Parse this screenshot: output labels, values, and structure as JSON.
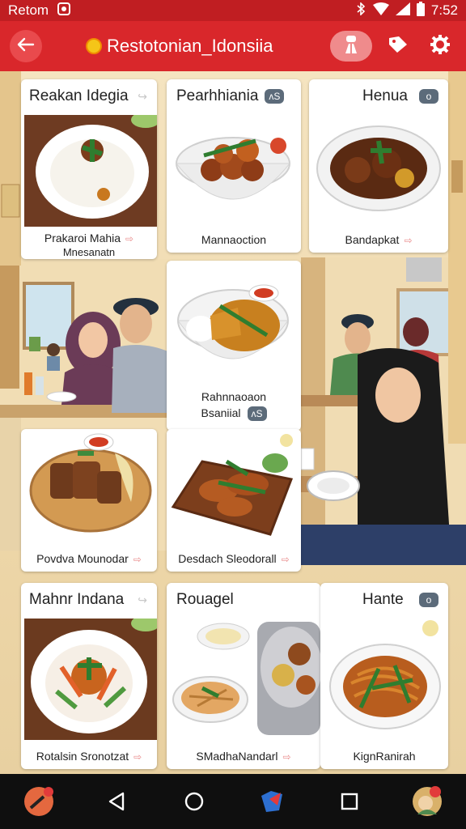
{
  "status_bar": {
    "carrier": "Retom",
    "time": "7:52",
    "icons": [
      "notification-icon",
      "bluetooth-icon",
      "wifi-icon",
      "signal-icon",
      "battery-icon"
    ]
  },
  "app_bar": {
    "title": "Restotonian_Idonsiia",
    "back_icon": "back-arrow-icon",
    "actions": [
      "chef-icon",
      "tag-icon",
      "settings-gear-icon"
    ]
  },
  "cards": [
    {
      "title": "Reakan Idegia",
      "caption": "Prakaroi Mahia",
      "caption2": "Mnesanatn"
    },
    {
      "title": "Pearhhiania",
      "badge": "ʌS",
      "caption": "Mannaoction"
    },
    {
      "title": "Henua",
      "badge": "o",
      "caption": "Bandapkat"
    },
    {
      "title": "",
      "caption": "Rahnnaoaon",
      "caption2": "Bsaniial",
      "badge": "ʌS"
    },
    {
      "title": "",
      "caption": "Povdva Mounodar"
    },
    {
      "title": "",
      "caption": "Desdach Sleodorall"
    },
    {
      "title": "Mahnr Indana",
      "caption": "Rotalsin Sronotzat"
    },
    {
      "title": "Rouagel",
      "caption": "SMadhaNandarl"
    },
    {
      "title": "Hante",
      "badge": "o",
      "caption": "KignRanirah"
    }
  ],
  "nav_bar": {
    "icons": [
      "app-avatar-icon",
      "back-triangle-icon",
      "home-circle-icon",
      "maps-app-icon",
      "recents-square-icon",
      "assistant-avatar-icon"
    ]
  },
  "colors": {
    "status_bar": "#c01e22",
    "app_bar": "#d9272b",
    "background": "#f3e2bf",
    "nav_bar": "#0f0f0f"
  }
}
